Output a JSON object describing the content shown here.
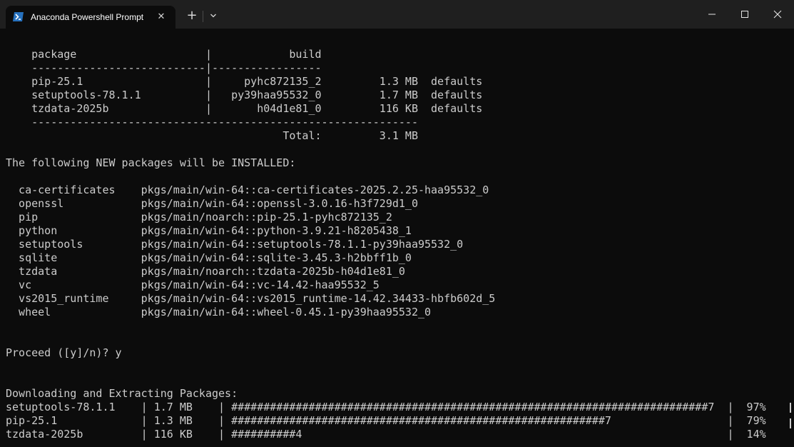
{
  "window": {
    "tab_title": "Anaconda Powershell Prompt",
    "tab_icon": "powershell-icon",
    "new_tab_symbol": "+",
    "dropdown_symbol": "⌵",
    "close_tab_symbol": "✕"
  },
  "terminal": {
    "package_header": "    package                    |            build",
    "package_rule": "    ---------------------------|-----------------",
    "packages": [
      "    pip-25.1                   |     pyhc872135_2         1.3 MB  defaults",
      "    setuptools-78.1.1          |   py39haa95532_0         1.7 MB  defaults",
      "    tzdata-2025b               |       h04d1e81_0         116 KB  defaults"
    ],
    "total_rule": "    ------------------------------------------------------------",
    "total_line": "                                           Total:         3.1 MB",
    "install_header": "The following NEW packages will be INSTALLED:",
    "install_list": [
      "  ca-certificates    pkgs/main/win-64::ca-certificates-2025.2.25-haa95532_0",
      "  openssl            pkgs/main/win-64::openssl-3.0.16-h3f729d1_0",
      "  pip                pkgs/main/noarch::pip-25.1-pyhc872135_2",
      "  python             pkgs/main/win-64::python-3.9.21-h8205438_1",
      "  setuptools         pkgs/main/win-64::setuptools-78.1.1-py39haa95532_0",
      "  sqlite             pkgs/main/win-64::sqlite-3.45.3-h2bbff1b_0",
      "  tzdata             pkgs/main/noarch::tzdata-2025b-h04d1e81_0",
      "  vc                 pkgs/main/win-64::vc-14.42-haa95532_5",
      "  vs2015_runtime     pkgs/main/win-64::vs2015_runtime-14.42.34433-hbfb602d_5",
      "  wheel              pkgs/main/win-64::wheel-0.45.1-py39haa95532_0"
    ],
    "proceed_prompt": "Proceed ([y]/n)? y",
    "download_header": "Downloading and Extracting Packages:",
    "downloads": [
      "setuptools-78.1.1    | 1.7 MB    | ##########################################################################7  |  97%",
      "pip-25.1             | 1.3 MB    | ##########################################################7                  |  79%",
      "tzdata-2025b         | 116 KB    | ##########4                                                                  |  14%"
    ]
  },
  "colors": {
    "titlebar_bg": "#1f1f1f",
    "terminal_bg": "#0c0c0c",
    "terminal_fg": "#cccccc",
    "powershell_blue": "#2671be"
  }
}
